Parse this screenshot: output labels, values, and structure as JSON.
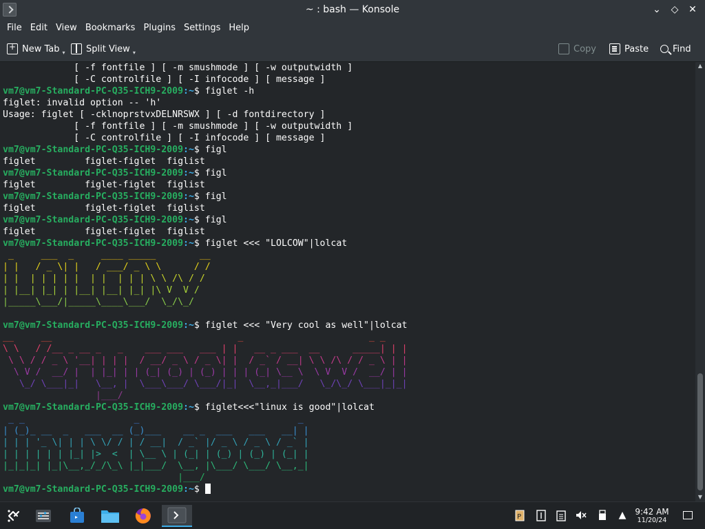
{
  "window": {
    "title": "~ : bash — Konsole",
    "controls": {
      "minimize": "⌄",
      "maximize": "◇",
      "close": "✕"
    }
  },
  "menu": [
    "File",
    "Edit",
    "View",
    "Bookmarks",
    "Plugins",
    "Settings",
    "Help"
  ],
  "toolbar": {
    "new_tab": "New Tab",
    "split_view": "Split View",
    "copy": "Copy",
    "paste": "Paste",
    "find": "Find"
  },
  "terminal": {
    "prompt_user": "vm7@vm7-Standard-PC-Q35-ICH9-2009",
    "prompt_dir": ":~",
    "lines": [
      {
        "type": "text",
        "text": "             [ -f fontfile ] [ -m smushmode ] [ -w outputwidth ]"
      },
      {
        "type": "text",
        "text": "             [ -C controlfile ] [ -I infocode ] [ message ]"
      },
      {
        "type": "cmd",
        "text": "$ figlet -h"
      },
      {
        "type": "text",
        "text": "figlet: invalid option -- 'h'"
      },
      {
        "type": "text",
        "text": "Usage: figlet [ -cklnoprstvxDELNRSWX ] [ -d fontdirectory ]"
      },
      {
        "type": "text",
        "text": "             [ -f fontfile ] [ -m smushmode ] [ -w outputwidth ]"
      },
      {
        "type": "text",
        "text": "             [ -C controlfile ] [ -I infocode ] [ message ]"
      },
      {
        "type": "cmd",
        "text": "$ figl"
      },
      {
        "type": "text",
        "text": "figlet         figlet-figlet  figlist"
      },
      {
        "type": "cmd",
        "text": "$ figl"
      },
      {
        "type": "text",
        "text": "figlet         figlet-figlet  figlist"
      },
      {
        "type": "cmd",
        "text": "$ figl"
      },
      {
        "type": "text",
        "text": "figlet         figlet-figlet  figlist"
      },
      {
        "type": "cmd",
        "text": "$ figl"
      },
      {
        "type": "text",
        "text": "figlet         figlet-figlet  figlist"
      },
      {
        "type": "cmd",
        "text": "$ figlet <<< \"LOLCOW\"|lolcat"
      },
      {
        "type": "art",
        "text": " _     ___  _     ____ _____        __",
        "color": "#f1c40f"
      },
      {
        "type": "art",
        "text": "| |   / _ \\| |   / ___/ _ \\ \\      / /",
        "color": "#e5d21a"
      },
      {
        "type": "art",
        "text": "| |  | | | | |  | |  | | | \\ \\ /\\ / / ",
        "color": "#c9d62a"
      },
      {
        "type": "art",
        "text": "| |__| |_| | |__| |__| |_| |\\ V  V /  ",
        "color": "#a9d43a"
      },
      {
        "type": "art",
        "text": "|_____\\___/|_____\\____\\___/  \\_/\\_/   ",
        "color": "#8bce4a"
      },
      {
        "type": "art",
        "text": "",
        "color": "#fcfcfc"
      },
      {
        "type": "cmd",
        "text": "$ figlet <<< \"Very cool as well\"|lolcat"
      },
      {
        "type": "art",
        "text": "__     __                                  _                       _ _ ",
        "color": "#e74c3c"
      },
      {
        "type": "art",
        "text": "\\ \\   / /__ _ __ _   _    ___ ___   ___ | |   __ _ ___  __      _____| | |",
        "color": "#e0406a"
      },
      {
        "type": "art",
        "text": " \\ \\ / / _ \\ '__| | | |  / __/ _ \\ / _ \\| |  / _` / __| \\ \\ /\\ / / _ \\ | |",
        "color": "#c23a8a"
      },
      {
        "type": "art",
        "text": "  \\ V /  __/ |  | |_| | | (_| (_) | (_) | | | (_| \\__ \\  \\ V  V /  __/ | |",
        "color": "#9b3aa6"
      },
      {
        "type": "art",
        "text": "   \\_/ \\___|_|   \\__, |  \\___\\___/ \\___/|_|  \\__,_|___/   \\_/\\_/ \\___|_|_|",
        "color": "#6f42b8"
      },
      {
        "type": "art",
        "text": "                 |___/                                                  ",
        "color": "#8e3a8e"
      },
      {
        "type": "cmd",
        "text": "$ figlet<<<\"linux is good\"|lolcat"
      },
      {
        "type": "art",
        "text": " _ _                    _                             _ ",
        "color": "#3d7ee0"
      },
      {
        "type": "art",
        "text": "| (_)_ __  _   ___  __ (_)___    __ _  ___   ___   __| |",
        "color": "#3a8fd0"
      },
      {
        "type": "art",
        "text": "| | | '_ \\| | | \\ \\/ / | / __|  / _` |/ _ \\ / _ \\ / _` |",
        "color": "#33a3b8"
      },
      {
        "type": "art",
        "text": "| | | | | | |_| |>  <  | \\__ \\ | (_| | (_) | (_) | (_| |",
        "color": "#2eb59a"
      },
      {
        "type": "art",
        "text": "|_|_|_| |_|\\__,_/_/\\_\\ |_|___/  \\__, |\\___/ \\___/ \\__,_|",
        "color": "#2dba7a"
      },
      {
        "type": "art",
        "text": "                                |___/                   ",
        "color": "#27ae60"
      },
      {
        "type": "cmd_cursor",
        "text": "$ "
      }
    ]
  },
  "taskbar": {
    "clock_time": "9:42 AM",
    "clock_date": "11/20/24",
    "apps": [
      "application-launcher-icon",
      "system-settings-icon",
      "discover-store-icon",
      "file-manager-icon",
      "firefox-icon",
      "konsole-icon"
    ]
  },
  "colors": {
    "prompt_user": "#27ae60",
    "prompt_dir": "#3daee9",
    "background": "#232629",
    "chrome": "#31363b"
  }
}
